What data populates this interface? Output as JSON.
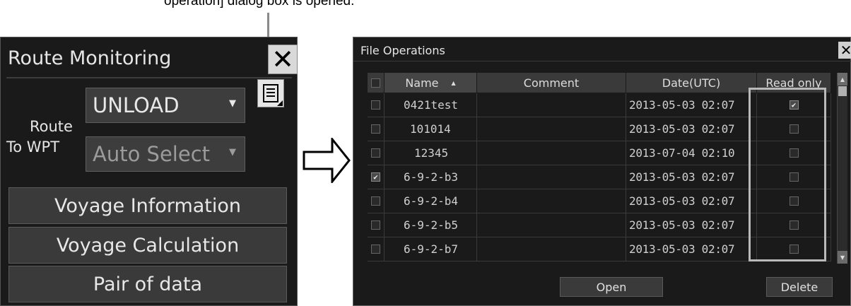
{
  "caption": "operation] dialog box is opened.",
  "route_monitoring": {
    "title": "Route Monitoring",
    "route_label": "Route",
    "route_value": "UNLOAD",
    "to_wpt_label": "To WPT",
    "to_wpt_value": "Auto Select",
    "buttons": [
      "Voyage Information",
      "Voyage Calculation",
      "Pair of data"
    ]
  },
  "file_operations": {
    "title": "File Operations",
    "columns": {
      "name": "Name",
      "comment": "Comment",
      "date": "Date(UTC)",
      "read_only": "Read only"
    },
    "sort_indicator": "▲",
    "rows": [
      {
        "checked": "",
        "name": "0421test",
        "comment": "",
        "date": "2013-05-03 02:07",
        "read_only": "✔"
      },
      {
        "checked": "",
        "name": "101014",
        "comment": "",
        "date": "2013-05-03 02:07",
        "read_only": ""
      },
      {
        "checked": "",
        "name": "12345",
        "comment": "",
        "date": "2013-07-04 02:10",
        "read_only": ""
      },
      {
        "checked": "✔",
        "name": "6-9-2-b3",
        "comment": "",
        "date": "2013-05-03 02:07",
        "read_only": ""
      },
      {
        "checked": "",
        "name": "6-9-2-b4",
        "comment": "",
        "date": "2013-05-03 02:07",
        "read_only": ""
      },
      {
        "checked": "",
        "name": "6-9-2-b5",
        "comment": "",
        "date": "2013-05-03 02:07",
        "read_only": ""
      },
      {
        "checked": "",
        "name": "6-9-2-b7",
        "comment": "",
        "date": "2013-05-03 02:07",
        "read_only": ""
      }
    ],
    "open_label": "Open",
    "delete_label": "Delete"
  },
  "colors": {
    "panel_bg": "#1a1a1a",
    "button_bg": "#3a3a3a",
    "text": "#e6e6e6",
    "highlight": "#b9b9b9"
  }
}
